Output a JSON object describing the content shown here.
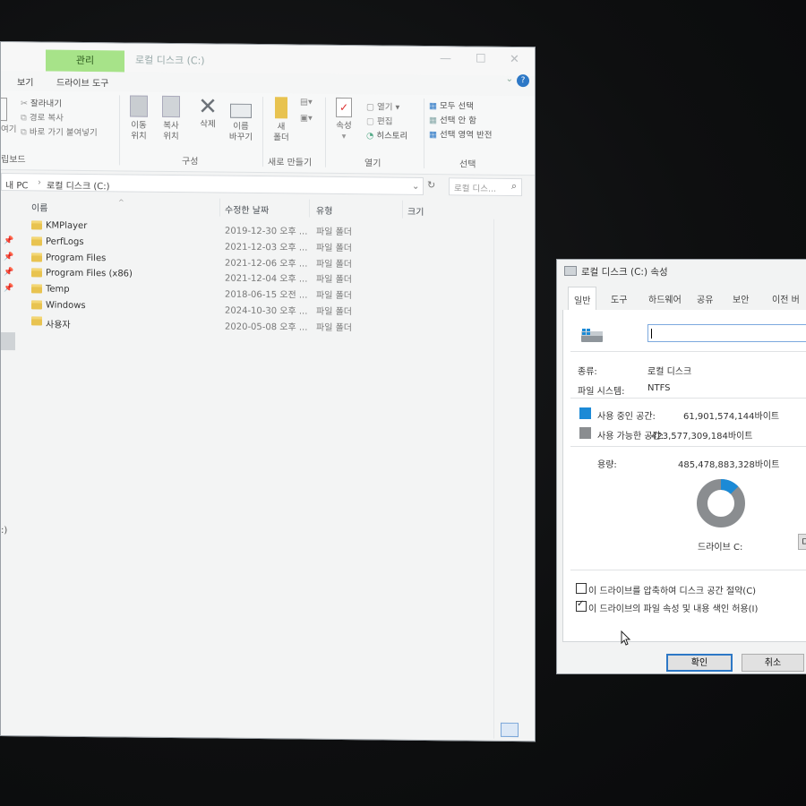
{
  "explorer": {
    "window_title": "로컬 디스크 (C:)",
    "manage_tab": "관리",
    "tabs": [
      "보기",
      "드라이브 도구"
    ],
    "ribbon": {
      "clipboard": {
        "cut": "잘라내기",
        "copy_path": "경로 복사",
        "paste_shortcut": "바로 가기 붙여넣기",
        "group": "립보드",
        "left_partial": "여기"
      },
      "organize": {
        "move_to": [
          "이동",
          "위치"
        ],
        "copy_to": [
          "복사",
          "위치"
        ],
        "delete": "삭제",
        "rename": [
          "이름",
          "바꾸기"
        ],
        "group": "구성"
      },
      "new": {
        "new_folder": [
          "새",
          "폴더"
        ],
        "group": "새로 만들기"
      },
      "open": {
        "properties": "속성",
        "open": "열기",
        "edit": "편집",
        "history": "히스토리",
        "group": "열기"
      },
      "select": {
        "select_all": "모두 선택",
        "select_none": "선택 안 함",
        "invert": "선택 영역 반전",
        "group": "선택"
      }
    },
    "address": {
      "crumb_pc": "내 PC",
      "separator": "›",
      "crumb_drive": "로컬 디스크 (C:)"
    },
    "search_placeholder": "로컬 디스...",
    "columns": {
      "name": "이름",
      "modified": "수정한 날짜",
      "type": "유형",
      "size": "크기"
    },
    "files": [
      {
        "name": "KMPlayer",
        "date": "2019-12-30 오후 ...",
        "type": "파일 폴더"
      },
      {
        "name": "PerfLogs",
        "date": "2021-12-03 오후 ...",
        "type": "파일 폴더"
      },
      {
        "name": "Program Files",
        "date": "2021-12-06 오후 ...",
        "type": "파일 폴더"
      },
      {
        "name": "Program Files (x86)",
        "date": "2021-12-04 오후 ...",
        "type": "파일 폴더"
      },
      {
        "name": "Temp",
        "date": "2018-06-15 오전 ...",
        "type": "파일 폴더"
      },
      {
        "name": "Windows",
        "date": "2024-10-30 오후 ...",
        "type": "파일 폴더"
      },
      {
        "name": "사용자",
        "date": "2020-05-08 오후 ...",
        "type": "파일 폴더"
      }
    ],
    "left_edge_text": ":)"
  },
  "properties": {
    "title": "로컬 디스크 (C:) 속성",
    "tabs": [
      "일반",
      "도구",
      "하드웨어",
      "공유",
      "보안",
      "이전 버"
    ],
    "type_label": "종류:",
    "type_value": "로컬 디스크",
    "fs_label": "파일 시스템:",
    "fs_value": "NTFS",
    "used_label": "사용 중인 공간:",
    "used_value": "61,901,574,144바이트",
    "free_label": "사용 가능한 공간:",
    "free_value": "423,577,309,184바이트",
    "capacity_label": "용량:",
    "capacity_value": "485,478,883,328바이트",
    "drive_caption": "드라이브 C:",
    "cleanup_partial": "디",
    "used_fraction": 0.1275,
    "compress_label": "이 드라이브를 압축하여 디스크 공간 절약(C)",
    "compress_checked": false,
    "index_label": "이 드라이브의 파일 속성 및 내용 색인 허용(I)",
    "index_checked": true,
    "ok": "확인",
    "cancel": "취소",
    "colors": {
      "used": "#1c8ad6",
      "free": "#8a8d90"
    }
  }
}
